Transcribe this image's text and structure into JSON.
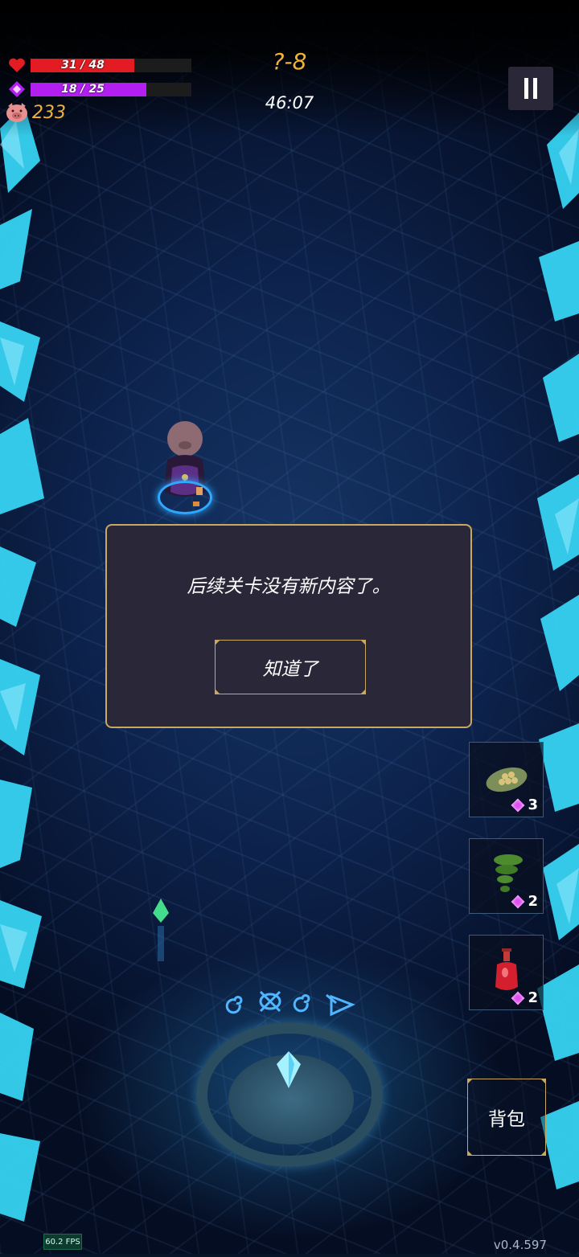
{
  "hud": {
    "hp_text": "31 / 48",
    "hp_fraction": 0.646,
    "hp_color": "#e31b23",
    "mp_text": "18 / 25",
    "mp_fraction": 0.72,
    "mp_color": "#b21ff0",
    "coins": "233",
    "stage": "?-8",
    "timer": "46:07",
    "icons": {
      "hp": "heart-icon",
      "mp": "diamond-icon",
      "coin": "pig-icon",
      "pause": "pause-icon"
    }
  },
  "dialog": {
    "message": "后续关卡没有新内容了。",
    "confirm_label": "知道了"
  },
  "items": [
    {
      "icon": "leaf-seeds-icon",
      "cost": "3"
    },
    {
      "icon": "green-tornado-icon",
      "cost": "2"
    },
    {
      "icon": "red-potion-icon",
      "cost": "2"
    }
  ],
  "bag_label": "背包",
  "fps": "60.2 FPS",
  "version": "v0.4.597",
  "colors": {
    "accent_gold": "#c9a862",
    "coin_text": "#f2b335",
    "dialog_bg": "#2a2738"
  }
}
